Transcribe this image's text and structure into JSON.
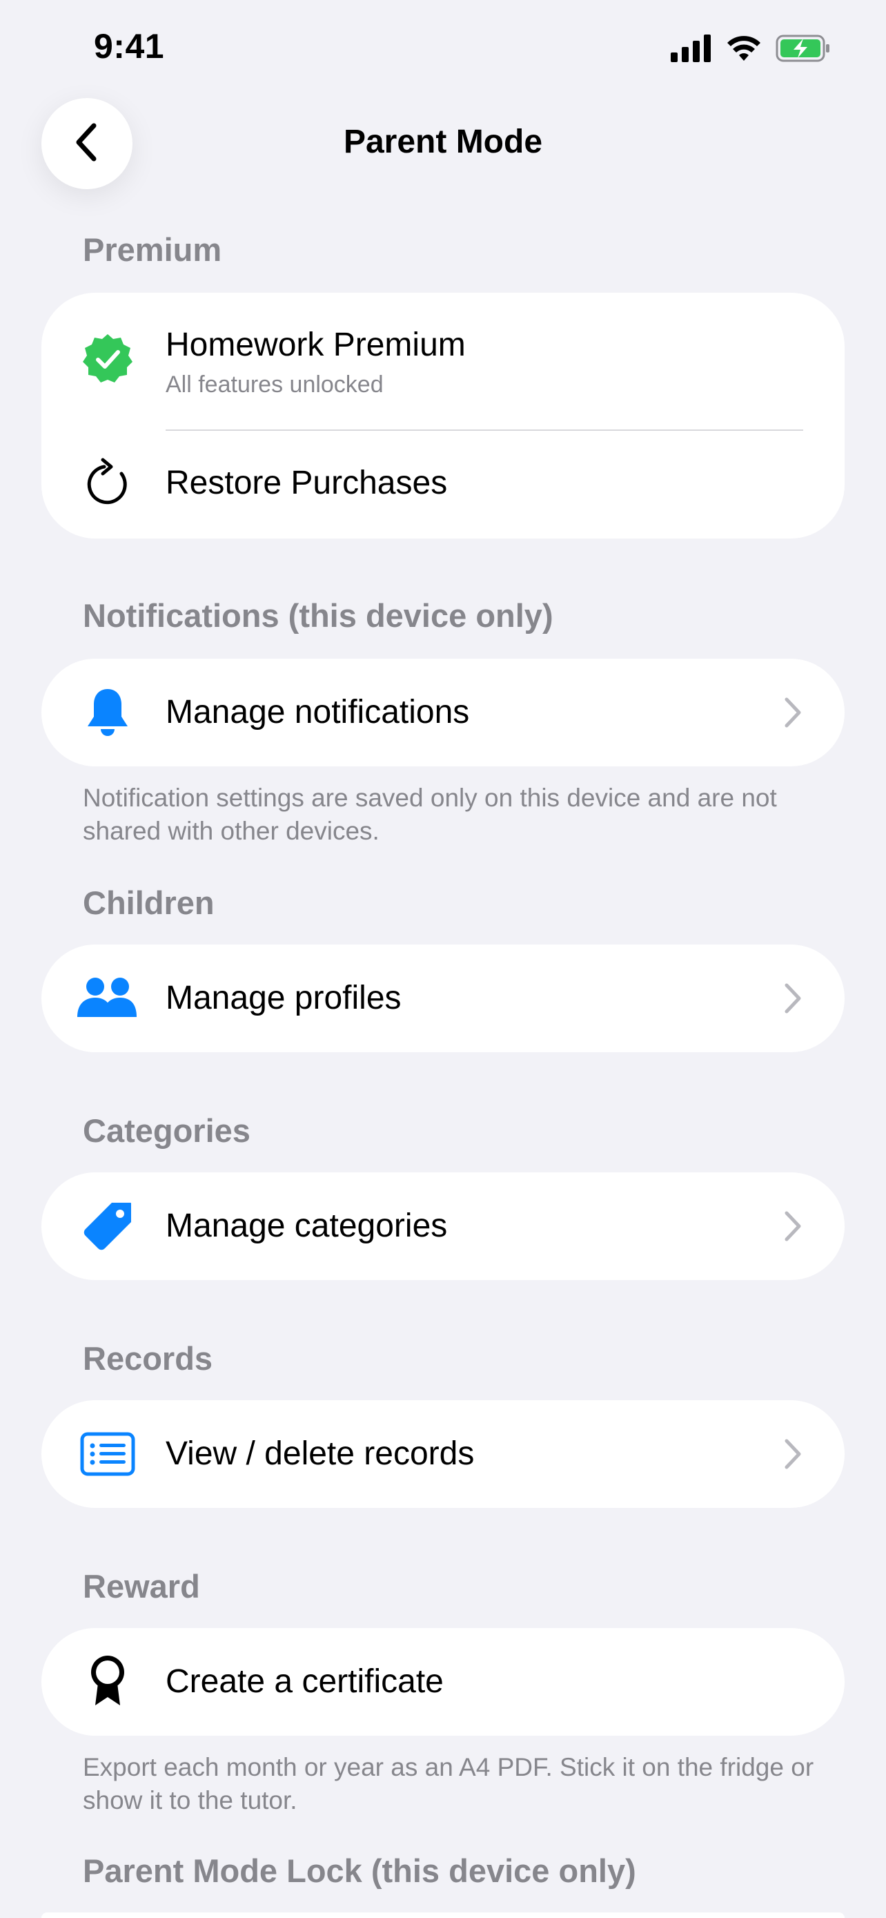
{
  "status_bar": {
    "time": "9:41"
  },
  "nav": {
    "title": "Parent Mode"
  },
  "sections": {
    "premium": {
      "header": "Premium",
      "rows": [
        {
          "label": "Homework Premium",
          "sublabel": "All features unlocked",
          "icon": "verified-badge-icon"
        },
        {
          "label": "Restore Purchases",
          "icon": "restore-icon"
        }
      ]
    },
    "notifications": {
      "header": "Notifications (this device only)",
      "row": {
        "label": "Manage notifications",
        "icon": "bell-icon"
      },
      "footnote": "Notification settings are saved only on this device and are not shared with other devices."
    },
    "children": {
      "header": "Children",
      "row": {
        "label": "Manage profiles",
        "icon": "people-icon"
      }
    },
    "categories": {
      "header": "Categories",
      "row": {
        "label": "Manage categories",
        "icon": "tag-icon"
      }
    },
    "records": {
      "header": "Records",
      "row": {
        "label": "View / delete records",
        "icon": "list-icon"
      }
    },
    "reward": {
      "header": "Reward",
      "row": {
        "label": "Create a certificate",
        "icon": "award-icon"
      },
      "footnote": "Export each month or year as an A4 PDF. Stick it on the fridge or show it to the tutor."
    },
    "lock": {
      "header": "Parent Mode Lock (this device only)"
    }
  },
  "colors": {
    "background": "#F2F2F7",
    "accent_blue": "#0A84FF",
    "success_green": "#34C759",
    "secondary_text": "#86868C"
  }
}
